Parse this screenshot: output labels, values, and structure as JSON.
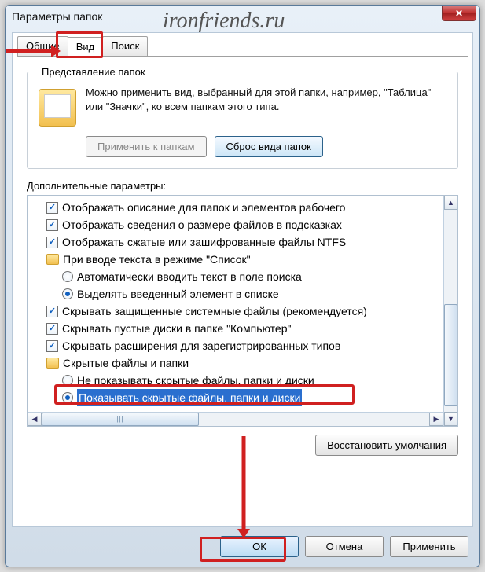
{
  "window": {
    "title": "Параметры папок"
  },
  "watermark": "ironfriends.ru",
  "tabs": {
    "general": "Общие",
    "view": "Вид",
    "search": "Поиск"
  },
  "group": {
    "legend": "Представление папок",
    "text": "Можно применить вид, выбранный для этой папки, например, \"Таблица\" или \"Значки\", ко всем папкам этого типа.",
    "apply_btn": "Применить к папкам",
    "reset_btn": "Сброс вида папок"
  },
  "advanced_label": "Дополнительные параметры:",
  "tree": {
    "i1": "Отображать описание для папок и элементов рабочего",
    "i2": "Отображать сведения о размере файлов в подсказках",
    "i3": "Отображать сжатые или зашифрованные файлы NTFS",
    "i4": "При вводе текста в режиме \"Список\"",
    "i5": "Автоматически вводить текст в поле поиска",
    "i6": "Выделять введенный элемент в списке",
    "i7": "Скрывать защищенные системные файлы (рекомендуется)",
    "i8": "Скрывать пустые диски в папке \"Компьютер\"",
    "i9": "Скрывать расширения для зарегистрированных типов",
    "i10": "Скрытые файлы и папки",
    "i11": "Не показывать скрытые файлы, папки и диски",
    "i12": "Показывать скрытые файлы, папки и диски"
  },
  "restore_btn": "Восстановить умолчания",
  "buttons": {
    "ok": "ОК",
    "cancel": "Отмена",
    "apply": "Применить"
  }
}
